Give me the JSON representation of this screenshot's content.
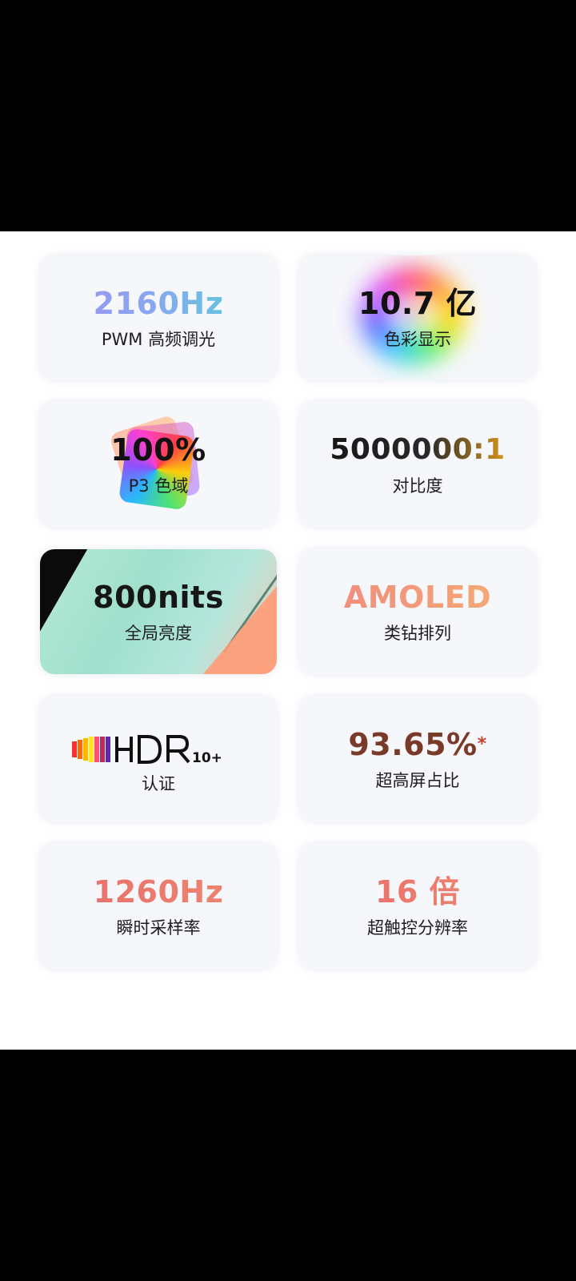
{
  "cards": [
    {
      "value": "2160Hz",
      "label": "PWM 高频调光"
    },
    {
      "value": "10.7 亿",
      "label": "色彩显示"
    },
    {
      "value": "100%",
      "label": "P3 色域"
    },
    {
      "value": "5000000:1",
      "label": "对比度"
    },
    {
      "value": "800nits",
      "label": "全局亮度"
    },
    {
      "value": "AMOLED",
      "label": "类钻排列"
    },
    {
      "value": "HDR10+",
      "label": "认证"
    },
    {
      "value": "93.65%",
      "value_suffix": "*",
      "label": "超高屏占比"
    },
    {
      "value": "1260Hz",
      "label": "瞬时采样率"
    },
    {
      "value": "16 倍",
      "label": "超触控分辨率"
    }
  ],
  "colors": {
    "pwm_gradient": [
      "#9d8ff2",
      "#52d3d6"
    ],
    "amoled_gradient": [
      "#f08a80",
      "#f5b070"
    ],
    "sampling_gradient": [
      "#e86a6a",
      "#ef8a70"
    ],
    "card_background": "#f6f7fa"
  }
}
